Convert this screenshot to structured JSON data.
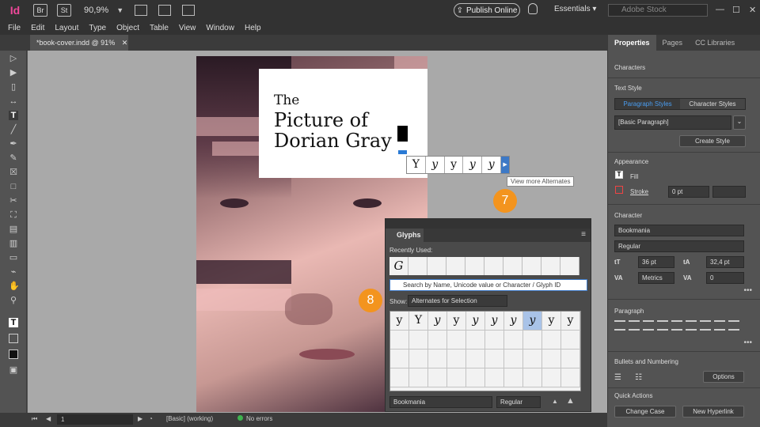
{
  "app": {
    "logo": "Id",
    "bridge": "Br",
    "stock": "St",
    "zoom": "90,9%",
    "publish_label": "Publish Online",
    "workspace": "Essentials",
    "search_placeholder": "Adobe Stock"
  },
  "menu": [
    "File",
    "Edit",
    "Layout",
    "Type",
    "Object",
    "Table",
    "View",
    "Window",
    "Help"
  ],
  "document_tab": "*book-cover.indd @ 91%",
  "cover": {
    "title_line1": "The",
    "title_line2": "Picture of",
    "title_line3": "Dorian Gray"
  },
  "alternates": {
    "glyphs": [
      "Y",
      "y",
      "y",
      "y",
      "y"
    ],
    "tooltip": "View more Alternates"
  },
  "callouts": {
    "seven": "7",
    "eight": "8"
  },
  "glyphs_panel": {
    "title": "Glyphs",
    "recently_used_label": "Recently Used:",
    "recent": [
      "G",
      "",
      "",
      "",
      "",
      "",
      "",
      "",
      "",
      ""
    ],
    "search_placeholder": "Search by Name, Unicode value or Character / Glyph ID",
    "show_label": "Show:",
    "show_value": "Alternates for Selection",
    "grid_row1": [
      "y",
      "Y",
      "y",
      "y",
      "y",
      "y",
      "y",
      "y",
      "y",
      "y"
    ],
    "font": "Bookmania",
    "style": "Regular"
  },
  "properties": {
    "tabs": [
      "Properties",
      "Pages",
      "CC Libraries"
    ],
    "characters_label": "Characters",
    "text_style_label": "Text Style",
    "para_styles": "Paragraph Styles",
    "char_styles": "Character Styles",
    "basic_para": "[Basic Paragraph]",
    "create_style": "Create Style",
    "appearance_label": "Appearance",
    "fill_label": "Fill",
    "stroke_label": "Stroke",
    "stroke_value": "0 pt",
    "character_label": "Character",
    "font": "Bookmania",
    "style": "Regular",
    "size": "36 pt",
    "leading": "32,4 pt",
    "kerning": "Metrics",
    "tracking": "0",
    "paragraph_label": "Paragraph",
    "bullets_label": "Bullets and Numbering",
    "options": "Options",
    "quick_actions_label": "Quick Actions",
    "change_case": "Change Case",
    "new_hyperlink": "New Hyperlink"
  },
  "status": {
    "page": "1",
    "style": "[Basic] (working)",
    "errors": "No errors"
  }
}
